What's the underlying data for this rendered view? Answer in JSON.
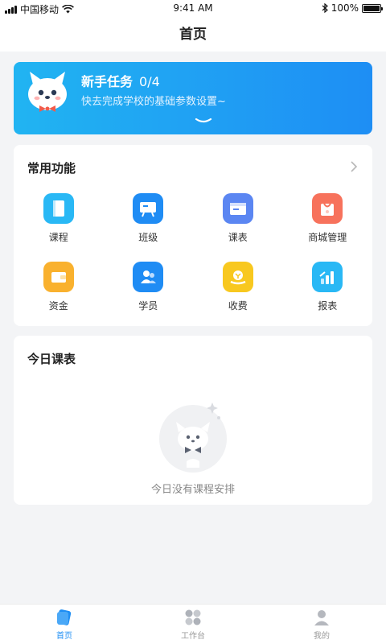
{
  "status_bar": {
    "carrier": "中国移动",
    "time": "9:41 AM",
    "battery": "100%",
    "battery_level": 1.0
  },
  "nav": {
    "title": "首页"
  },
  "banner": {
    "title": "新手任务",
    "progress": "0/4",
    "subtitle": "快去完成学校的基础参数设置~"
  },
  "common_functions": {
    "title": "常用功能",
    "items": [
      {
        "label": "课程",
        "icon": "course-book-icon",
        "color": "#29b8f5"
      },
      {
        "label": "班级",
        "icon": "class-board-icon",
        "color": "#1f8cf4"
      },
      {
        "label": "课表",
        "icon": "timetable-icon",
        "color": "#5b86f2"
      },
      {
        "label": "商城管理",
        "icon": "shop-bag-icon",
        "color": "#f7725c"
      },
      {
        "label": "资金",
        "icon": "wallet-icon",
        "color": "#f9b12e"
      },
      {
        "label": "学员",
        "icon": "students-icon",
        "color": "#1f8cf4"
      },
      {
        "label": "收费",
        "icon": "fee-coin-icon",
        "color": "#f8c81f"
      },
      {
        "label": "报表",
        "icon": "report-chart-icon",
        "color": "#29b8f5"
      }
    ]
  },
  "today_schedule": {
    "title": "今日课表",
    "empty_text": "今日没有课程安排"
  },
  "tabbar": {
    "items": [
      {
        "label": "首页",
        "icon": "home-card-icon",
        "active": true
      },
      {
        "label": "工作台",
        "icon": "workbench-grid-icon",
        "active": false
      },
      {
        "label": "我的",
        "icon": "profile-person-icon",
        "active": false
      }
    ]
  },
  "colors": {
    "accent": "#1e8ef4",
    "banner_start": "#21b4f2",
    "banner_end": "#1e8ef4",
    "background": "#f3f4f6"
  }
}
